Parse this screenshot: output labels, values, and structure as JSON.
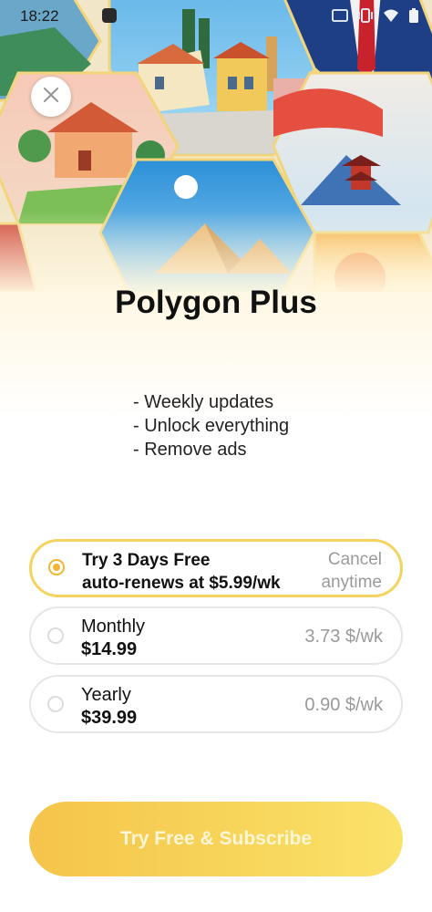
{
  "status_bar": {
    "time": "18:22"
  },
  "hero": {
    "close_icon": "close-icon"
  },
  "title": "Polygon Plus",
  "features": [
    "- Weekly updates",
    "- Unlock everything",
    "- Remove ads"
  ],
  "plans": [
    {
      "line1": "Try 3 Days Free",
      "line2": "auto-renews at $5.99/wk",
      "side1": "Cancel",
      "side2": "anytime",
      "selected": true
    },
    {
      "line1": "Monthly",
      "line2": "$14.99",
      "side": "3.73 $/wk",
      "selected": false
    },
    {
      "line1": "Yearly",
      "line2": "$39.99",
      "side": "0.90 $/wk",
      "selected": false
    }
  ],
  "cta": {
    "label": "Try Free & Subscribe"
  },
  "colors": {
    "accent": "#f4d35e",
    "radio_selected": "#f1b52f",
    "cta_start": "#f5c44a",
    "cta_end": "#fbe26a"
  }
}
